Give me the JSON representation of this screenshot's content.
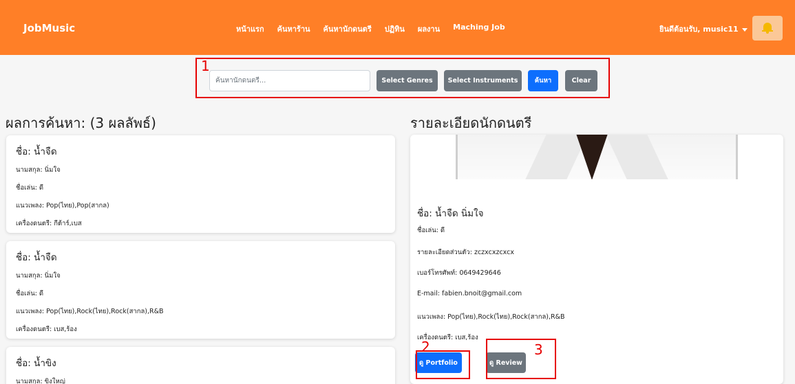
{
  "navbar": {
    "brand": "JobMusic",
    "links": [
      "หน้าแรก",
      "ค้นหาร้าน",
      "ค้นหานักดนตรี",
      "ปฏิทิน",
      "ผลงาน",
      "Maching Job"
    ],
    "user_greeting": "ยินดีต้อนรับ, music11",
    "bell_icon": "bell-icon"
  },
  "search": {
    "placeholder": "ค้นหานักดนตรี...",
    "select_genres_label": "Select Genres",
    "select_instruments_label": "Select Instruments",
    "search_label": "ค้นหา",
    "clear_label": "Clear"
  },
  "annotations": {
    "a1": "1",
    "a2": "2",
    "a3": "3"
  },
  "results": {
    "title": "ผลการค้นหา: (3 ผลลัพธ์)",
    "items": [
      {
        "name": "ชื่อ: น้ำจืด",
        "surname": "นามสกุล: นิ่มใจ",
        "nickname": "ชื่อเล่น: ดี",
        "genres": "แนวเพลง: Pop(ไทย),Pop(สากล)",
        "instruments": "เครื่องดนตรี: กีต้าร์,เบส"
      },
      {
        "name": "ชื่อ: น้ำจืด",
        "surname": "นามสกุล: นิ่มใจ",
        "nickname": "ชื่อเล่น: ดี",
        "genres": "แนวเพลง: Pop(ไทย),Rock(ไทย),Rock(สากล),R&B",
        "instruments": "เครื่องดนตรี: เบส,ร้อง"
      },
      {
        "name": "ชื่อ: น้ำขิง",
        "surname": "นามสกุล: ขิงใหญ่"
      }
    ]
  },
  "detail": {
    "title": "รายละเอียดนักดนตรี",
    "name": "ชื่อ: น้ำจืด นิ่มใจ",
    "nickname": "ชื่อเล่น: ดี",
    "bio": "รายละเอียดส่วนตัว: zczxcxzcxcx",
    "phone": "เบอร์โทรศัพท์: 0649429646",
    "email": "E-mail: fabien.bnoit@gmail.com",
    "genres": "แนวเพลง: Pop(ไทย),Rock(ไทย),Rock(สากล),R&B",
    "instruments": "เครื่องดนตรี: เบส,ร้อง",
    "portfolio_label": "ดู Portfolio",
    "review_label": "ดู Review"
  },
  "colors": {
    "navbar": "#ff7f27",
    "primary": "#0d6efd",
    "secondary": "#6c757d",
    "annotation": "#e60000"
  }
}
